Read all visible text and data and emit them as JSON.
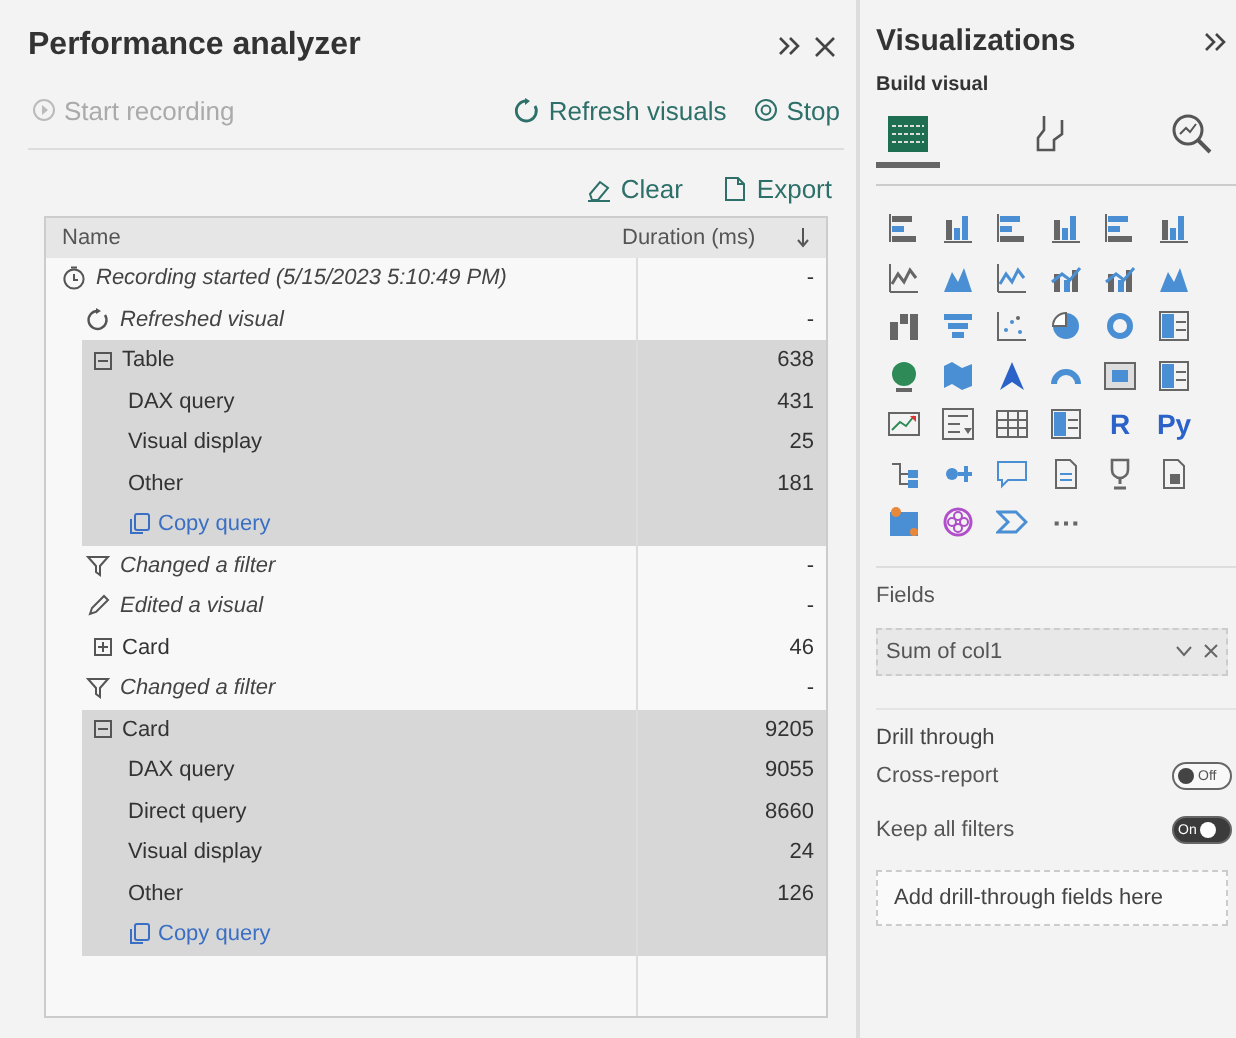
{
  "performance_analyzer": {
    "title": "Performance analyzer",
    "actions": [
      {
        "kind": "start",
        "label": "Start recording",
        "disabled": true
      },
      {
        "kind": "refresh",
        "label": "Refresh visuals",
        "disabled": false
      },
      {
        "kind": "stop",
        "label": "Stop",
        "disabled": false
      }
    ],
    "tools": [
      {
        "kind": "clear",
        "label": "Clear"
      },
      {
        "kind": "export",
        "label": "Export"
      }
    ],
    "columns": [
      "Name",
      "Duration (ms)"
    ],
    "rows": [
      {
        "kind": "recording",
        "label": "Recording started (5/15/2023 5:10:49 PM)",
        "duration": "-"
      },
      {
        "kind": "refresh",
        "label": "Refreshed visual",
        "duration": "-"
      },
      {
        "kind": "visual",
        "label": "Table",
        "duration": "638",
        "expanded": true,
        "children": [
          {
            "kind": "metric",
            "label": "DAX query",
            "duration": "431"
          },
          {
            "kind": "metric",
            "label": "Visual display",
            "duration": "25"
          },
          {
            "kind": "metric",
            "label": "Other",
            "duration": "181"
          },
          {
            "kind": "link",
            "label": "Copy query"
          }
        ]
      },
      {
        "kind": "filter",
        "label": "Changed a filter",
        "duration": "-"
      },
      {
        "kind": "edit",
        "label": "Edited a visual",
        "duration": "-"
      },
      {
        "kind": "visual",
        "label": "Card",
        "duration": "46",
        "expanded": false
      },
      {
        "kind": "filter",
        "label": "Changed a filter",
        "duration": "-"
      },
      {
        "kind": "visual",
        "label": "Card",
        "duration": "9205",
        "expanded": true,
        "children": [
          {
            "kind": "metric",
            "label": "DAX query",
            "duration": "9055"
          },
          {
            "kind": "metric",
            "label": "Direct query",
            "duration": "8660"
          },
          {
            "kind": "metric",
            "label": "Visual display",
            "duration": "24"
          },
          {
            "kind": "metric",
            "label": "Other",
            "duration": "126"
          },
          {
            "kind": "link",
            "label": "Copy query"
          }
        ]
      }
    ]
  },
  "visualizations": {
    "title": "Visualizations",
    "subtitle": "Build visual",
    "build_tabs": [
      {
        "kind": "build",
        "selected": true
      },
      {
        "kind": "format",
        "selected": false
      },
      {
        "kind": "analytics",
        "selected": false
      }
    ],
    "gallery_texts": [
      "R",
      "Py",
      "⋯"
    ],
    "fields_label": "Fields",
    "fields": [
      {
        "label": "Sum of col1"
      }
    ],
    "drill_title": "Drill through",
    "toggles": [
      {
        "label": "Cross-report",
        "on": false,
        "state_text": "Off"
      },
      {
        "label": "Keep all filters",
        "on": true,
        "state_text": "On"
      }
    ],
    "drop_zone": "Add drill-through fields here"
  }
}
